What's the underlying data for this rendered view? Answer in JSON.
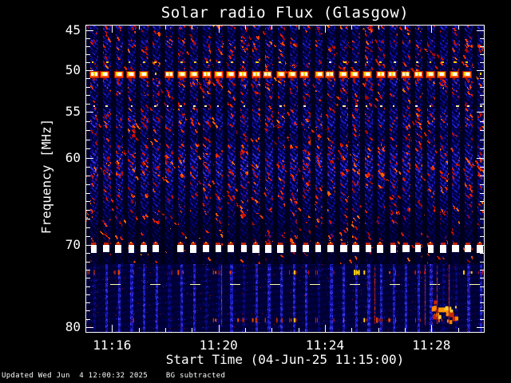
{
  "status_bar": {
    "text": "Updated Wed Jun  4 12:00:32 2025    BG subtracted"
  },
  "chart_data": {
    "type": "heatmap",
    "subtype": "solar-radio-spectrogram",
    "title": "Solar radio Flux (Glasgow)",
    "xlabel": "Start Time (04-Jun-25 11:15:00)",
    "ylabel": "Frequency [MHz]",
    "background_note": "BG subtracted dynamic spectrum, dark-blue background with red RFI speckle and white saturated interference bands",
    "x_axis": {
      "start": "11:15:00",
      "span_minutes": 15,
      "major_ticks": [
        {
          "label": "11:16",
          "minute": 1
        },
        {
          "label": "11:20",
          "minute": 5
        },
        {
          "label": "11:24",
          "minute": 9
        },
        {
          "label": "11:28",
          "minute": 13
        }
      ],
      "minor_tick_every_minutes": 1
    },
    "y_axis": {
      "unit": "MHz",
      "major_ticks": [
        {
          "label": "45",
          "mhz": 45
        },
        {
          "label": "50",
          "mhz": 50
        },
        {
          "label": "55",
          "mhz": 55
        },
        {
          "label": "60",
          "mhz": 60
        },
        {
          "label": "70",
          "mhz": 70
        },
        {
          "label": "80",
          "mhz": 80
        }
      ],
      "minor_tick_every_mhz": 1,
      "scale_anchors": [
        [
          44.31,
          0
        ],
        [
          45,
          0.0181
        ],
        [
          50,
          0.1477
        ],
        [
          55,
          0.2824
        ],
        [
          60,
          0.4326
        ],
        [
          70,
          0.715
        ],
        [
          80,
          0.9819
        ],
        [
          80.67,
          1
        ]
      ]
    },
    "palette": {
      "stops": [
        [
          0,
          "#000014"
        ],
        [
          0.1,
          "#000046"
        ],
        [
          0.2,
          "#0b0b96"
        ],
        [
          0.32,
          "#2424cf"
        ],
        [
          0.44,
          "#4646ff"
        ],
        [
          0.5,
          "#6a0a66"
        ],
        [
          0.56,
          "#a50500"
        ],
        [
          0.66,
          "#d81400"
        ],
        [
          0.75,
          "#ff3c00"
        ],
        [
          0.83,
          "#ff7b00"
        ],
        [
          0.9,
          "#ffc400"
        ],
        [
          0.96,
          "#ffef70"
        ],
        [
          1,
          "#ffffff"
        ]
      ]
    },
    "modulation_period_seconds": 28,
    "activity_bands": [
      [
        44.31,
        44.95,
        0.9,
        0.85
      ],
      [
        44.95,
        46.2,
        0.5,
        0.4
      ],
      [
        46.2,
        47.2,
        0.75,
        0.7
      ],
      [
        47.2,
        48.3,
        0.6,
        0.5
      ],
      [
        48.3,
        49.3,
        0.65,
        0.6
      ],
      [
        49.3,
        50.05,
        0.6,
        0.55
      ],
      [
        50.05,
        50.95,
        0.35,
        0.3
      ],
      [
        50.95,
        51.9,
        0.85,
        0.8
      ],
      [
        51.9,
        53.4,
        0.65,
        0.6
      ],
      [
        53.4,
        54.6,
        0.55,
        0.45
      ],
      [
        54.6,
        55.4,
        0.7,
        0.6
      ],
      [
        55.4,
        56.7,
        0.85,
        0.8
      ],
      [
        56.7,
        58.5,
        0.6,
        0.5
      ],
      [
        58.5,
        59.5,
        0.75,
        0.65
      ],
      [
        59.5,
        62.1,
        0.95,
        0.9
      ],
      [
        62.1,
        63.5,
        0.8,
        0.75
      ],
      [
        63.5,
        64.8,
        0.7,
        0.65
      ],
      [
        64.8,
        66.2,
        0.6,
        0.55
      ],
      [
        66.2,
        67.6,
        0.5,
        0.45
      ],
      [
        67.6,
        69.2,
        0.4,
        0.3
      ],
      [
        69.2,
        70.1,
        0.35,
        0.35
      ],
      [
        70.1,
        71,
        0.3,
        0.25
      ],
      [
        71,
        72.3,
        0.3,
        0.2
      ],
      [
        72.3,
        80.67,
        0.12,
        0.05
      ]
    ],
    "features": [
      {
        "kind": "blob_row",
        "mhz": 50.5,
        "color": "#ffffff",
        "note": "saturated white/yellow RFI blobs every 28 s"
      },
      {
        "kind": "dot_row",
        "mhz": 48.95,
        "color": "#ffcc00"
      },
      {
        "kind": "dot_row",
        "mhz": 54.3,
        "color": "#ffee99"
      },
      {
        "kind": "square_row",
        "mhz": 70.55,
        "color": "#ffffff",
        "cap_color": "#c22200",
        "note": "row of white saturated squares every 28 s"
      },
      {
        "kind": "dashed_line",
        "mhz": 74.75,
        "color": "#ffffaa"
      },
      {
        "kind": "streak_row",
        "mhz": 73.35,
        "color": "#cc1100"
      },
      {
        "kind": "streak_row",
        "mhz": 79.15,
        "color": "#cc2200"
      },
      {
        "kind": "cluster",
        "mhz": [
          76.5,
          79.3
        ],
        "minute": [
          12.95,
          14.05
        ],
        "color": "#ff8800"
      },
      {
        "kind": "vertical_streaks",
        "mhz": [
          72.4,
          79.6
        ],
        "minutes": [
          5.1,
          10.85,
          12.75,
          13.2,
          13.65
        ],
        "color": "#aa1100"
      }
    ]
  }
}
